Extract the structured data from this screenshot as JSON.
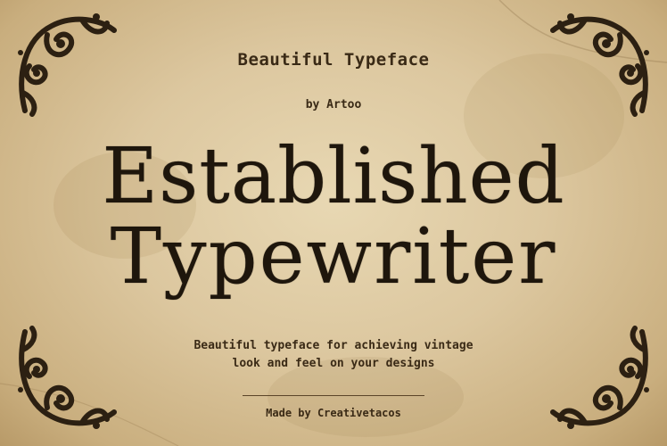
{
  "poster": {
    "kicker": "Beautiful Typeface",
    "byline": "by Artoo",
    "headline_line1": "Established",
    "headline_line2": "Typewriter",
    "tagline_line1": "Beautiful typeface for achieving vintage",
    "tagline_line2": "look and feel on your designs",
    "credit": "Made by Creativetacos"
  },
  "ornaments": [
    "corner-flourish-icon",
    "corner-flourish-icon",
    "corner-flourish-icon",
    "corner-flourish-icon"
  ],
  "colors": {
    "paper": "#dcc79f",
    "ink": "#1e160c",
    "text": "#3a2a16"
  }
}
